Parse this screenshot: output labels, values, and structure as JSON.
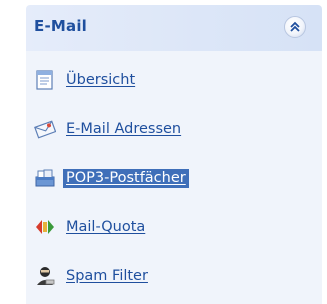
{
  "section": {
    "title": "E-Mail"
  },
  "items": [
    {
      "label": "Übersicht",
      "icon": "document-icon"
    },
    {
      "label": "E-Mail Adressen",
      "icon": "envelope-icon"
    },
    {
      "label": "POP3-Postfächer",
      "icon": "mailbox-icon",
      "selected": true
    },
    {
      "label": "Mail-Quota",
      "icon": "quota-icon"
    },
    {
      "label": "Spam Filter",
      "icon": "spam-filter-icon"
    }
  ],
  "colors": {
    "link": "#1f4f9e",
    "selected_bg": "#3f6fb9",
    "panel_bg": "#f0f4fb"
  }
}
